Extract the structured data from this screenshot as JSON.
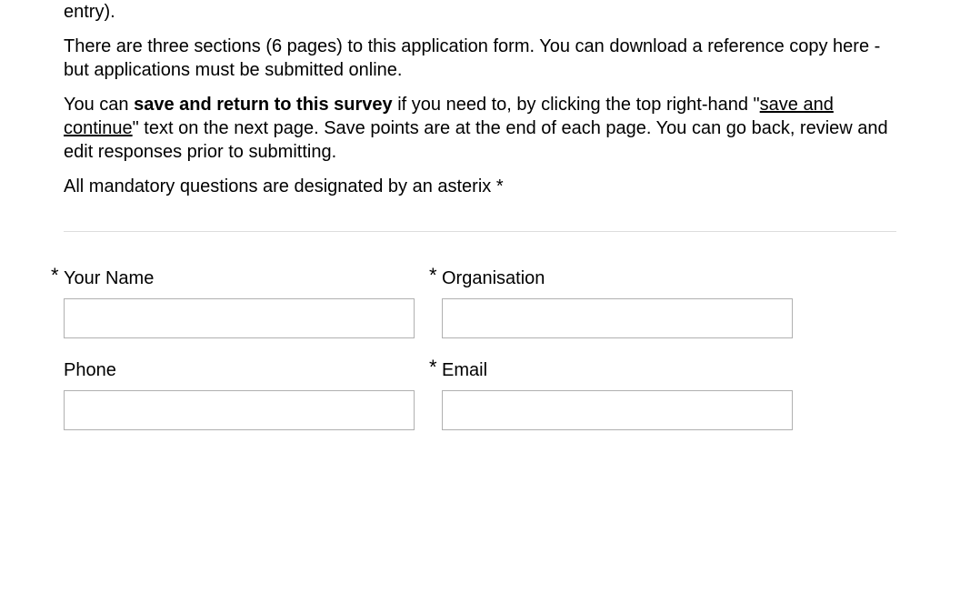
{
  "intro": {
    "p1": "entry).",
    "p2": "There are three sections (6 pages) to this application form.  You can download a reference copy here -  but applications must be submitted online.",
    "p3_a": "You can ",
    "p3_bold": "save and return to this survey",
    "p3_b": " if you need to, by clicking the top right-hand \"",
    "p3_underline": "save and continue",
    "p3_c": "\" text on the next page.  Save points are at the end of each page.  You can go back, review and edit responses prior to submitting.",
    "p4": "All mandatory questions are designated by an asterix *"
  },
  "fields": {
    "asterisk": "*",
    "name": {
      "label": "Your Name",
      "required": true,
      "value": ""
    },
    "organisation": {
      "label": "Organisation",
      "required": true,
      "value": ""
    },
    "phone": {
      "label": "Phone",
      "required": false,
      "value": ""
    },
    "email": {
      "label": "Email",
      "required": true,
      "value": ""
    }
  }
}
